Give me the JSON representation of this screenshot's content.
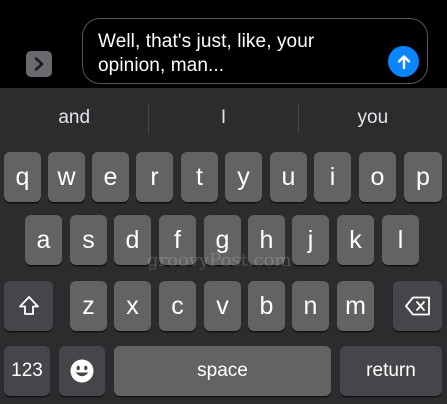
{
  "compose": {
    "message_text": "Well, that's just, like, your opinion, man...",
    "accent_color": "#0a84ff"
  },
  "predictions": [
    "and",
    "I",
    "you"
  ],
  "rows": {
    "row1": [
      "q",
      "w",
      "e",
      "r",
      "t",
      "y",
      "u",
      "i",
      "o",
      "p"
    ],
    "row2": [
      "a",
      "s",
      "d",
      "f",
      "g",
      "h",
      "j",
      "k",
      "l"
    ],
    "row3": [
      "z",
      "x",
      "c",
      "v",
      "b",
      "n",
      "m"
    ]
  },
  "bottom_row": {
    "numbers_label": "123",
    "space_label": "space",
    "return_label": "return"
  },
  "watermark": "groovyPost.com"
}
